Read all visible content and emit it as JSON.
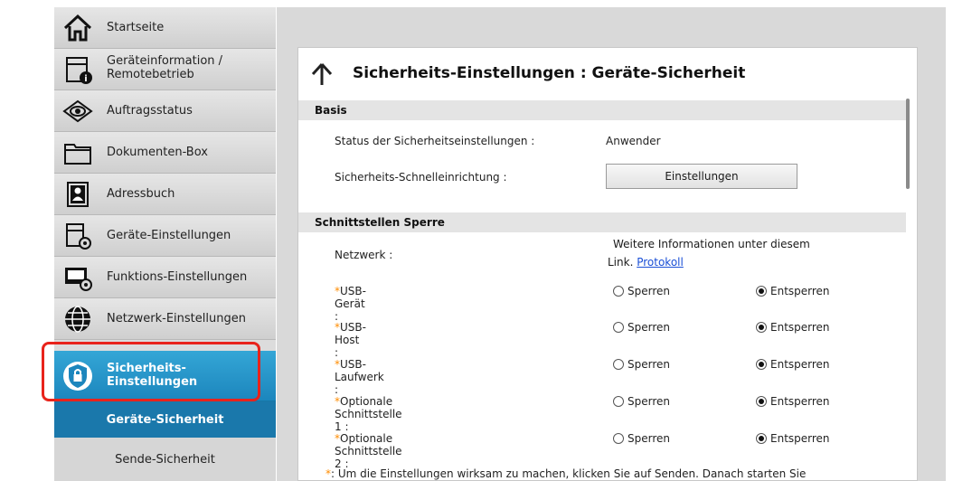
{
  "sidebar": {
    "items": [
      {
        "label": "Startseite"
      },
      {
        "label": "Geräteinformation /",
        "label2": "Remotebetrieb"
      },
      {
        "label": "Auftragsstatus"
      },
      {
        "label": "Dokumenten-Box"
      },
      {
        "label": "Adressbuch"
      },
      {
        "label": "Geräte-Einstellungen"
      },
      {
        "label": "Funktions-Einstellungen"
      },
      {
        "label": "Netzwerk-Einstellungen"
      },
      {
        "label": "Sicherheits-",
        "label2": "Einstellungen"
      }
    ],
    "subitems": [
      {
        "label": "Geräte-Sicherheit"
      },
      {
        "label": "Sende-Sicherheit"
      }
    ]
  },
  "main": {
    "title": "Sicherheits-Einstellungen : Geräte-Sicherheit",
    "basis": {
      "header": "Basis",
      "status_label": "Status der Sicherheitseinstellungen :",
      "status_value": "Anwender",
      "quick_label": "Sicherheits-Schnelleinrichtung :",
      "quick_button": "Einstellungen"
    },
    "interfaces": {
      "header": "Schnittstellen Sperre",
      "network_label": "Netzwerk :",
      "network_info_line1": "Weitere Informationen unter diesem",
      "network_info_line2": "Link.",
      "network_link": "Protokoll",
      "asterisk": "*",
      "lock_label": "Sperren",
      "unlock_label": "Entsperren",
      "rows": [
        {
          "label": "USB-Gerät :",
          "selected": "Entsperren"
        },
        {
          "label": "USB-Host :",
          "selected": "Entsperren"
        },
        {
          "label": "USB-Laufwerk :",
          "selected": "Entsperren"
        },
        {
          "label": "Optionale Schnittstelle 1 :",
          "selected": "Entsperren"
        },
        {
          "label": "Optionale Schnittstelle 2 :",
          "selected": "Entsperren"
        }
      ]
    },
    "footer_note": ": Um die Einstellungen wirksam zu machen, klicken Sie auf Senden. Danach starten Sie"
  },
  "colors": {
    "accent": "#1c86bd",
    "highlight": "#e8231b",
    "asterisk": "#ff8c00",
    "link": "#1a4fd6"
  }
}
